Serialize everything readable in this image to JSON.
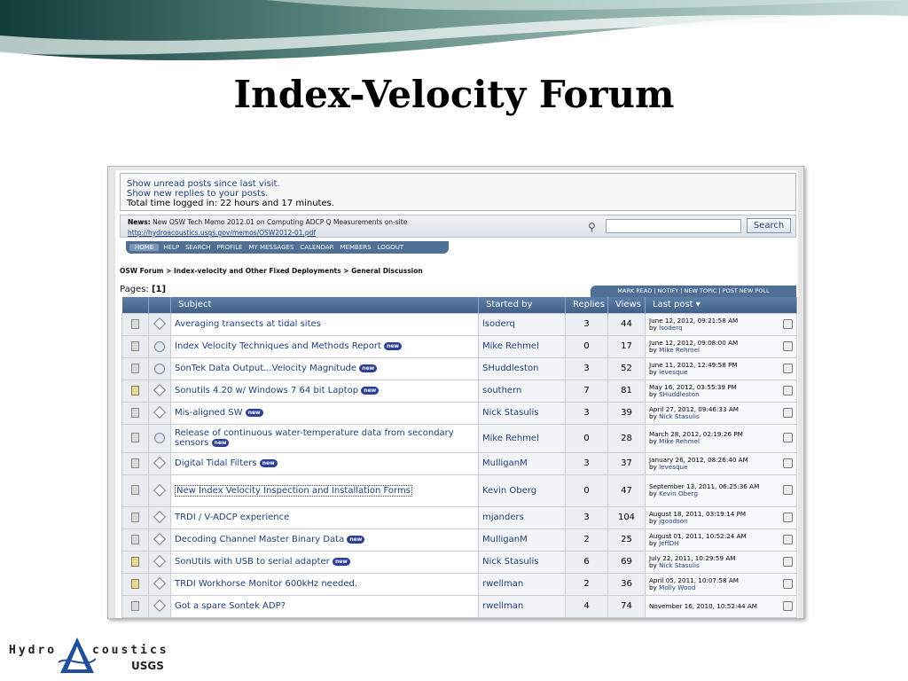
{
  "slide": {
    "title": "Index-Velocity Forum"
  },
  "userbox": {
    "line1": "Show unread posts since last visit.",
    "line2": "Show new replies to your posts.",
    "line3": "Total time logged in: 22 hours and 17 minutes."
  },
  "news": {
    "label": "News:",
    "text": "New OSW Tech Memo 2012.01 on Computing ADCP Q Measurements on-site",
    "link": "http://hydroacoustics.usgs.gov/memos/OSW2012-01.pdf"
  },
  "search": {
    "placeholder": "",
    "button": "Search"
  },
  "menu": [
    "HOME",
    "HELP",
    "SEARCH",
    "PROFILE",
    "MY MESSAGES",
    "CALENDAR",
    "MEMBERS",
    "LOGOUT"
  ],
  "breadcrumb": "OSW Forum > Index-velocity and Other Fixed Deployments > General Discussion",
  "pages": {
    "label": "Pages:",
    "current": "[1]"
  },
  "actions": "MARK READ | NOTIFY | NEW TOPIC | POST NEW POLL",
  "columns": {
    "subject": "Subject",
    "started": "Started by",
    "replies": "Replies",
    "views": "Views",
    "last": "Last post"
  },
  "new_badge": "new",
  "topics": [
    {
      "subject": "Averaging transects at tidal sites",
      "new": false,
      "started": "lsoderq",
      "replies": "3",
      "views": "44",
      "date": "June 12, 2012, 09:21:58 AM",
      "by": "lsoderq",
      "status": "diamond",
      "locked": false
    },
    {
      "subject": "Index Velocity Techniques and Methods Report",
      "new": true,
      "started": "Mike Rehmel",
      "replies": "0",
      "views": "17",
      "date": "June 12, 2012, 09:08:00 AM",
      "by": "Mike Rehmel",
      "status": "circle",
      "locked": false
    },
    {
      "subject": "SonTek Data Output...Velocity Magnitude",
      "new": true,
      "started": "SHuddleston",
      "replies": "3",
      "views": "52",
      "date": "June 11, 2012, 12:49:58 PM",
      "by": "levesque",
      "status": "circle",
      "locked": false
    },
    {
      "subject": "Sonutils 4.20 w/ Windows 7 64 bit Laptop",
      "new": true,
      "started": "southern",
      "replies": "7",
      "views": "81",
      "date": "May 16, 2012, 03:55:39 PM",
      "by": "SHuddleston",
      "status": "diamond",
      "locked": true
    },
    {
      "subject": "Mis-aligned SW",
      "new": true,
      "started": "Nick Stasulis",
      "replies": "3",
      "views": "39",
      "date": "April 27, 2012, 09:46:33 AM",
      "by": "Nick Stasulis",
      "status": "diamond",
      "locked": false
    },
    {
      "subject": "Release of continuous water-temperature data from secondary sensors",
      "new": true,
      "started": "Mike Rehmel",
      "replies": "0",
      "views": "28",
      "date": "March 28, 2012, 02:19:26 PM",
      "by": "Mike Rehmel",
      "status": "circle",
      "locked": false
    },
    {
      "subject": "Digital Tidal Filters",
      "new": true,
      "started": "MulliganM",
      "replies": "3",
      "views": "37",
      "date": "January 26, 2012, 08:26:40 AM",
      "by": "levesque",
      "status": "diamond",
      "locked": false
    },
    {
      "subject": "New Index Velocity Inspection and Installation Forms",
      "new": false,
      "started": "Kevin Oberg",
      "replies": "0",
      "views": "47",
      "date": "September 13, 2011, 06:25:36 AM",
      "by": "Kevin Oberg",
      "status": "diamond",
      "locked": false
    },
    {
      "subject": "TRDI / V-ADCP experience",
      "new": false,
      "started": "mjanders",
      "replies": "3",
      "views": "104",
      "date": "August 18, 2011, 03:19:14 PM",
      "by": "jgoodson",
      "status": "diamond",
      "locked": false
    },
    {
      "subject": "Decoding Channel Master Binary Data",
      "new": true,
      "started": "MulliganM",
      "replies": "2",
      "views": "25",
      "date": "August 01, 2011, 10:52:24 AM",
      "by": "JeffDH",
      "status": "diamond",
      "locked": false
    },
    {
      "subject": "SonUtils with USB to serial adapter",
      "new": true,
      "started": "Nick Stasulis",
      "replies": "6",
      "views": "69",
      "date": "July 22, 2011, 10:29:59 AM",
      "by": "Nick Stasulis",
      "status": "diamond",
      "locked": true
    },
    {
      "subject": "TRDI Workhorse Monitor 600kHz needed.",
      "new": false,
      "started": "rwellman",
      "replies": "2",
      "views": "36",
      "date": "April 05, 2011, 10:07:58 AM",
      "by": "Molly Wood",
      "status": "diamond",
      "locked": true
    },
    {
      "subject": "Got a spare Sontek ADP?",
      "new": false,
      "started": "rwellman",
      "replies": "4",
      "views": "74",
      "date": "November 16, 2010, 10:52:44 AM",
      "by": "",
      "status": "diamond",
      "locked": false
    }
  ],
  "by_prefix": "by",
  "logo": {
    "word1": "Hydro",
    "word2": "coustics",
    "agency": "USGS"
  },
  "colors": {
    "header": "#4f6f95",
    "link": "#1f3f7a",
    "badge": "#2d3f9b"
  }
}
